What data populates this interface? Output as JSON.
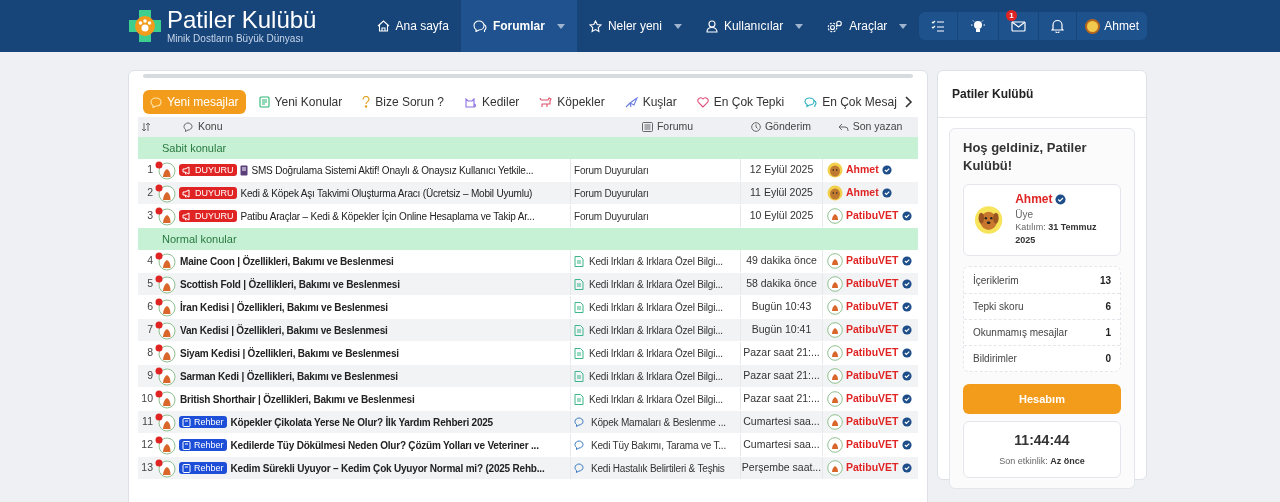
{
  "header": {
    "logo": {
      "title": "Patiler Kulübü",
      "subtitle": "Minik Dostların Büyük Dünyası"
    },
    "nav": [
      {
        "label": "Ana sayfa",
        "selected": false,
        "dropdown": false
      },
      {
        "label": "Forumlar",
        "selected": true,
        "dropdown": true
      },
      {
        "label": "Neler yeni",
        "selected": false,
        "dropdown": true
      },
      {
        "label": "Kullanıcılar",
        "selected": false,
        "dropdown": true
      },
      {
        "label": "Araçlar",
        "selected": false,
        "dropdown": true
      }
    ],
    "user_bar": {
      "message_count": "1",
      "username": "Ahmet"
    }
  },
  "tabs": [
    {
      "label": "Yeni mesajlar",
      "selected": true
    },
    {
      "label": "Yeni Konular",
      "selected": false
    },
    {
      "label": "Bize Sorun ?",
      "selected": false
    },
    {
      "label": "Kediler",
      "selected": false
    },
    {
      "label": "Köpekler",
      "selected": false
    },
    {
      "label": "Kuşlar",
      "selected": false
    },
    {
      "label": "En Çok Tepki",
      "selected": false
    },
    {
      "label": "En Çok Mesaj",
      "selected": false
    }
  ],
  "table": {
    "columns": [
      "Konu",
      "Forumu",
      "Gönderim",
      "Son yazan"
    ],
    "groups": [
      {
        "title": "Sabit konular",
        "rows": [
          {
            "number": "1",
            "prefix": {
              "label": "DUYURU",
              "kind": "announcement"
            },
            "title": "SMS Doğrulama Sistemi Aktif! Onaylı & Onaysız Kullanıcı Yetkile...",
            "unread": false,
            "forum": "Forum Duyuruları",
            "date": "12 Eylül 2025",
            "author": "Ahmet"
          },
          {
            "number": "2",
            "prefix": {
              "label": "DUYURU",
              "kind": "announcement"
            },
            "title": "Kedi & Köpek Aşı Takvimi Oluşturma Aracı (Ücretsiz – Mobil Uyumlu)",
            "unread": false,
            "forum": "Forum Duyuruları",
            "date": "11 Eylül 2025",
            "author": "Ahmet"
          },
          {
            "number": "3",
            "prefix": {
              "label": "DUYURU",
              "kind": "announcement"
            },
            "title": "Patibu Araçlar – Kedi & Köpekler İçin Online Hesaplama ve Takip Ar...",
            "unread": false,
            "forum": "Forum Duyuruları",
            "date": "10 Eylül 2025",
            "author": "PatibuVET"
          }
        ]
      },
      {
        "title": "Normal konular",
        "rows": [
          {
            "number": "4",
            "title": "Maine Coon | Özellikleri, Bakımı ve Beslenmesi",
            "unread": true,
            "forum": "Kedi Irkları & Irklara Özel Bilgi...",
            "date": "49 dakika önce",
            "author": "PatibuVET"
          },
          {
            "number": "5",
            "title": "Scottish Fold | Özellikleri, Bakımı ve Beslenmesi",
            "unread": true,
            "forum": "Kedi Irkları & Irklara Özel Bilgi...",
            "date": "58 dakika önce",
            "author": "PatibuVET"
          },
          {
            "number": "6",
            "title": "İran Kedisi | Özellikleri, Bakımı ve Beslenmesi",
            "unread": true,
            "forum": "Kedi Irkları & Irklara Özel Bilgi...",
            "date": "Bugün 10:43",
            "author": "PatibuVET"
          },
          {
            "number": "7",
            "title": "Van Kedisi | Özellikleri, Bakımı ve Beslenmesi",
            "unread": true,
            "forum": "Kedi Irkları & Irklara Özel Bilgi...",
            "date": "Bugün 10:41",
            "author": "PatibuVET"
          },
          {
            "number": "8",
            "title": "Siyam Kedisi | Özellikleri, Bakımı ve Beslenmesi",
            "unread": true,
            "forum": "Kedi Irkları & Irklara Özel Bilgi...",
            "date": "Pazar saat 21:...",
            "author": "PatibuVET"
          },
          {
            "number": "9",
            "title": "Sarman Kedi | Özellikleri, Bakımı ve Beslenmesi",
            "unread": true,
            "forum": "Kedi Irkları & Irklara Özel Bilgi...",
            "date": "Pazar saat 21:...",
            "author": "PatibuVET"
          },
          {
            "number": "10",
            "title": "British Shorthair | Özellikleri, Bakımı ve Beslenmesi",
            "unread": true,
            "forum": "Kedi Irkları & Irklara Özel Bilgi...",
            "date": "Pazar saat 21:...",
            "author": "PatibuVET"
          },
          {
            "number": "11",
            "prefix": {
              "label": "Rehber",
              "kind": "guide"
            },
            "title": "Köpekler Çikolata Yerse Ne Olur? İlk Yardım Rehberi 2025",
            "unread": true,
            "forum": "Köpek Mamaları & Beslenme ...",
            "date": "Cumartesi saa...",
            "author": "PatibuVET"
          },
          {
            "number": "12",
            "prefix": {
              "label": "Rehber",
              "kind": "guide"
            },
            "title": "Kedilerde Tüy Dökülmesi Neden Olur? Çözüm Yolları ve Veteriner ...",
            "unread": true,
            "forum": "Kedi Tüy Bakımı, Tarama ve T...",
            "date": "Cumartesi saa...",
            "author": "PatibuVET"
          },
          {
            "number": "13",
            "prefix": {
              "label": "Rehber",
              "kind": "guide"
            },
            "title": "Kedim Sürekli Uyuyor – Kedim Çok Uyuyor Normal mi? (2025 Rehb...",
            "unread": true,
            "forum": "Kedi Hastalık Belirtileri & Teşhis",
            "date": "Perşembe saat...",
            "author": "PatibuVET"
          }
        ]
      }
    ]
  },
  "sidebar": {
    "title": "Patiler Kulübü",
    "welcome": "Hoş geldiniz, Patiler Kulübü!",
    "profile": {
      "name": "Ahmet",
      "role": "Üye",
      "joined_label": "Katılım:",
      "joined": "31 Temmuz 2025"
    },
    "stats": [
      {
        "label": "İçeriklerim",
        "value": "13"
      },
      {
        "label": "Tepki skoru",
        "value": "6"
      },
      {
        "label": "Okunmamış mesajlar",
        "value": "1"
      },
      {
        "label": "Bildirimler",
        "value": "0"
      }
    ],
    "button": "Hesabım",
    "clock": {
      "time": "11:44:44",
      "label": "Son etkinlik:",
      "value": "Az önce"
    }
  }
}
